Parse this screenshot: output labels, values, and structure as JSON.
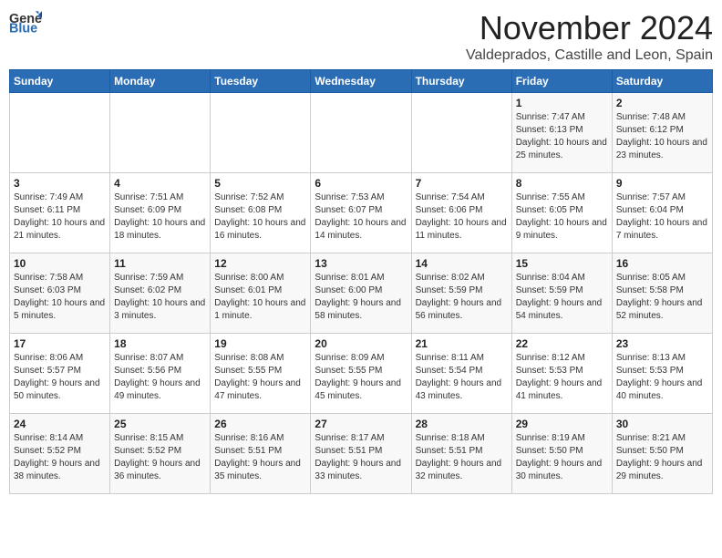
{
  "header": {
    "logo_general": "General",
    "logo_blue": "Blue",
    "month": "November 2024",
    "location": "Valdeprados, Castille and Leon, Spain"
  },
  "weekdays": [
    "Sunday",
    "Monday",
    "Tuesday",
    "Wednesday",
    "Thursday",
    "Friday",
    "Saturday"
  ],
  "weeks": [
    [
      {
        "day": "",
        "content": ""
      },
      {
        "day": "",
        "content": ""
      },
      {
        "day": "",
        "content": ""
      },
      {
        "day": "",
        "content": ""
      },
      {
        "day": "",
        "content": ""
      },
      {
        "day": "1",
        "content": "Sunrise: 7:47 AM\nSunset: 6:13 PM\nDaylight: 10 hours and 25 minutes."
      },
      {
        "day": "2",
        "content": "Sunrise: 7:48 AM\nSunset: 6:12 PM\nDaylight: 10 hours and 23 minutes."
      }
    ],
    [
      {
        "day": "3",
        "content": "Sunrise: 7:49 AM\nSunset: 6:11 PM\nDaylight: 10 hours and 21 minutes."
      },
      {
        "day": "4",
        "content": "Sunrise: 7:51 AM\nSunset: 6:09 PM\nDaylight: 10 hours and 18 minutes."
      },
      {
        "day": "5",
        "content": "Sunrise: 7:52 AM\nSunset: 6:08 PM\nDaylight: 10 hours and 16 minutes."
      },
      {
        "day": "6",
        "content": "Sunrise: 7:53 AM\nSunset: 6:07 PM\nDaylight: 10 hours and 14 minutes."
      },
      {
        "day": "7",
        "content": "Sunrise: 7:54 AM\nSunset: 6:06 PM\nDaylight: 10 hours and 11 minutes."
      },
      {
        "day": "8",
        "content": "Sunrise: 7:55 AM\nSunset: 6:05 PM\nDaylight: 10 hours and 9 minutes."
      },
      {
        "day": "9",
        "content": "Sunrise: 7:57 AM\nSunset: 6:04 PM\nDaylight: 10 hours and 7 minutes."
      }
    ],
    [
      {
        "day": "10",
        "content": "Sunrise: 7:58 AM\nSunset: 6:03 PM\nDaylight: 10 hours and 5 minutes."
      },
      {
        "day": "11",
        "content": "Sunrise: 7:59 AM\nSunset: 6:02 PM\nDaylight: 10 hours and 3 minutes."
      },
      {
        "day": "12",
        "content": "Sunrise: 8:00 AM\nSunset: 6:01 PM\nDaylight: 10 hours and 1 minute."
      },
      {
        "day": "13",
        "content": "Sunrise: 8:01 AM\nSunset: 6:00 PM\nDaylight: 9 hours and 58 minutes."
      },
      {
        "day": "14",
        "content": "Sunrise: 8:02 AM\nSunset: 5:59 PM\nDaylight: 9 hours and 56 minutes."
      },
      {
        "day": "15",
        "content": "Sunrise: 8:04 AM\nSunset: 5:59 PM\nDaylight: 9 hours and 54 minutes."
      },
      {
        "day": "16",
        "content": "Sunrise: 8:05 AM\nSunset: 5:58 PM\nDaylight: 9 hours and 52 minutes."
      }
    ],
    [
      {
        "day": "17",
        "content": "Sunrise: 8:06 AM\nSunset: 5:57 PM\nDaylight: 9 hours and 50 minutes."
      },
      {
        "day": "18",
        "content": "Sunrise: 8:07 AM\nSunset: 5:56 PM\nDaylight: 9 hours and 49 minutes."
      },
      {
        "day": "19",
        "content": "Sunrise: 8:08 AM\nSunset: 5:55 PM\nDaylight: 9 hours and 47 minutes."
      },
      {
        "day": "20",
        "content": "Sunrise: 8:09 AM\nSunset: 5:55 PM\nDaylight: 9 hours and 45 minutes."
      },
      {
        "day": "21",
        "content": "Sunrise: 8:11 AM\nSunset: 5:54 PM\nDaylight: 9 hours and 43 minutes."
      },
      {
        "day": "22",
        "content": "Sunrise: 8:12 AM\nSunset: 5:53 PM\nDaylight: 9 hours and 41 minutes."
      },
      {
        "day": "23",
        "content": "Sunrise: 8:13 AM\nSunset: 5:53 PM\nDaylight: 9 hours and 40 minutes."
      }
    ],
    [
      {
        "day": "24",
        "content": "Sunrise: 8:14 AM\nSunset: 5:52 PM\nDaylight: 9 hours and 38 minutes."
      },
      {
        "day": "25",
        "content": "Sunrise: 8:15 AM\nSunset: 5:52 PM\nDaylight: 9 hours and 36 minutes."
      },
      {
        "day": "26",
        "content": "Sunrise: 8:16 AM\nSunset: 5:51 PM\nDaylight: 9 hours and 35 minutes."
      },
      {
        "day": "27",
        "content": "Sunrise: 8:17 AM\nSunset: 5:51 PM\nDaylight: 9 hours and 33 minutes."
      },
      {
        "day": "28",
        "content": "Sunrise: 8:18 AM\nSunset: 5:51 PM\nDaylight: 9 hours and 32 minutes."
      },
      {
        "day": "29",
        "content": "Sunrise: 8:19 AM\nSunset: 5:50 PM\nDaylight: 9 hours and 30 minutes."
      },
      {
        "day": "30",
        "content": "Sunrise: 8:21 AM\nSunset: 5:50 PM\nDaylight: 9 hours and 29 minutes."
      }
    ]
  ]
}
